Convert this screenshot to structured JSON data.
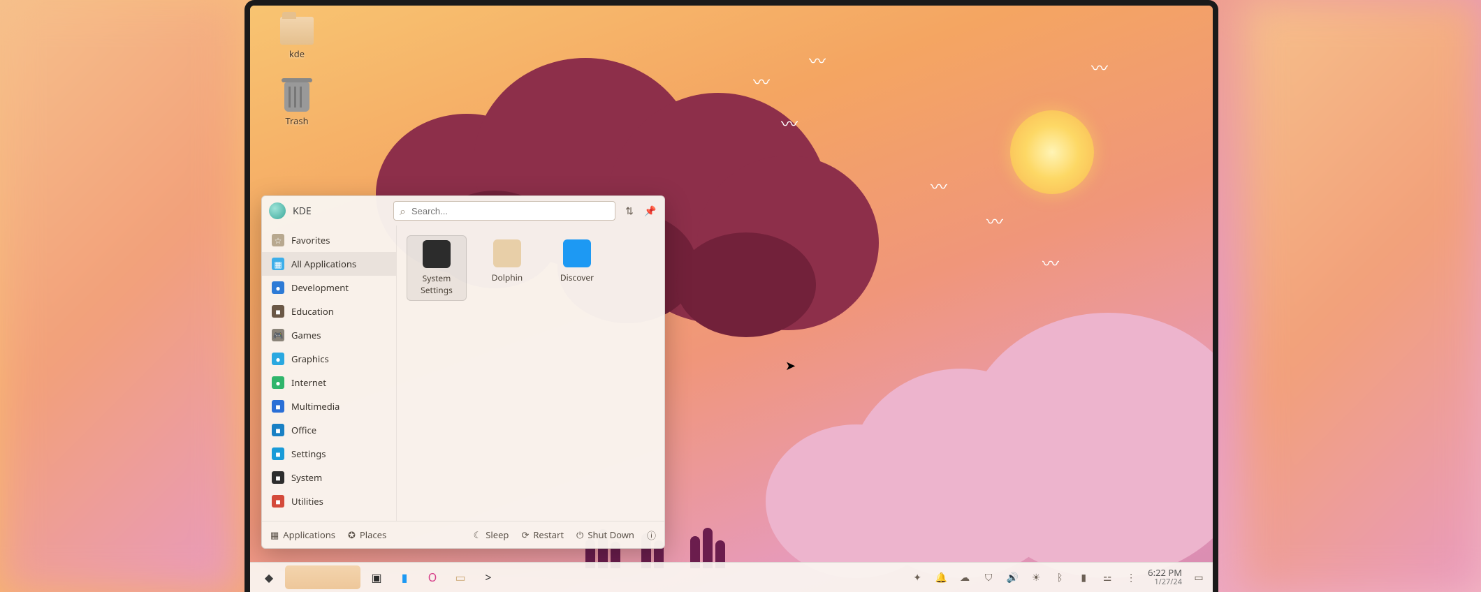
{
  "desktop": {
    "icons": [
      {
        "name": "kde",
        "label": "kde",
        "kind": "folder"
      },
      {
        "name": "trash",
        "label": "Trash",
        "kind": "trash"
      }
    ]
  },
  "launcher": {
    "user": "KDE",
    "search_placeholder": "Search...",
    "categories": [
      {
        "id": "favorites",
        "label": "Favorites",
        "color": "#b8a88f",
        "glyph": "☆"
      },
      {
        "id": "all",
        "label": "All Applications",
        "color": "#3daee9",
        "glyph": "▦",
        "selected": true
      },
      {
        "id": "development",
        "label": "Development",
        "color": "#2e7bd6",
        "glyph": "●"
      },
      {
        "id": "education",
        "label": "Education",
        "color": "#6b5846",
        "glyph": "■"
      },
      {
        "id": "games",
        "label": "Games",
        "color": "#8a8378",
        "glyph": "🎮"
      },
      {
        "id": "graphics",
        "label": "Graphics",
        "color": "#2aa8e0",
        "glyph": "●"
      },
      {
        "id": "internet",
        "label": "Internet",
        "color": "#2fb56b",
        "glyph": "●"
      },
      {
        "id": "multimedia",
        "label": "Multimedia",
        "color": "#2a6fd6",
        "glyph": "■"
      },
      {
        "id": "office",
        "label": "Office",
        "color": "#1980c4",
        "glyph": "■"
      },
      {
        "id": "settings",
        "label": "Settings",
        "color": "#1a9bd8",
        "glyph": "■"
      },
      {
        "id": "system",
        "label": "System",
        "color": "#2d2d2d",
        "glyph": "■"
      },
      {
        "id": "utilities",
        "label": "Utilities",
        "color": "#d44a3a",
        "glyph": "■"
      }
    ],
    "apps": [
      {
        "id": "system-settings",
        "label": "System\nSettings",
        "color": "#2c2c2c",
        "selected": true
      },
      {
        "id": "dolphin",
        "label": "Dolphin",
        "color": "#e8cfa8"
      },
      {
        "id": "discover",
        "label": "Discover",
        "color": "#1d99f3"
      }
    ],
    "footer": {
      "applications": "Applications",
      "places": "Places",
      "sleep": "Sleep",
      "restart": "Restart",
      "shutdown": "Shut Down"
    }
  },
  "taskbar": {
    "pinned": [
      {
        "id": "launcher",
        "glyph": "◆",
        "color": "#3d3d3d"
      },
      {
        "id": "active-win",
        "glyph": "",
        "color": "#eec79a",
        "active": true
      },
      {
        "id": "monitor",
        "glyph": "▣",
        "color": "#2b2b2b"
      },
      {
        "id": "dolphin",
        "glyph": "▮",
        "color": "#1d99f3"
      },
      {
        "id": "opera",
        "glyph": "O",
        "color": "#d6408a"
      },
      {
        "id": "files",
        "glyph": "▭",
        "color": "#cba874"
      },
      {
        "id": "konsole",
        "glyph": ">",
        "color": "#2b2b2b"
      }
    ],
    "tray_icons": [
      "star-icon",
      "bell-icon",
      "cloud-icon",
      "shield-icon",
      "volume-icon",
      "brightness-icon",
      "bluetooth-icon",
      "battery-icon",
      "wifi-icon",
      "network-icon"
    ],
    "clock": {
      "time": "6:22 PM",
      "date": "1/27/24"
    }
  },
  "accent_color": "#3daee9"
}
